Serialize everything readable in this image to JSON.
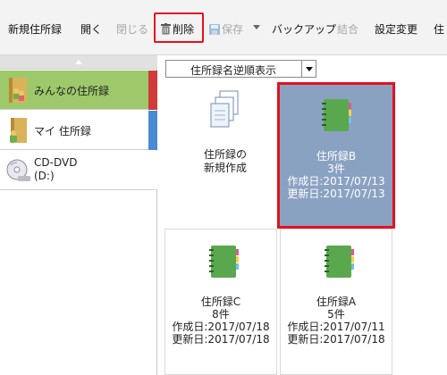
{
  "toolbar": {
    "new_addressbook": "新規住所録",
    "open": "開く",
    "close": "閉じる",
    "delete": "削除",
    "save": "保存",
    "backup": "バックアップ",
    "merge": "結合",
    "settings": "設定変更",
    "more": "住"
  },
  "sidebar": {
    "items": [
      {
        "label": "みんなの住所録",
        "selected": true,
        "stripe": "#d03a3a"
      },
      {
        "label": "マイ 住所録",
        "selected": false,
        "stripe": "#4a8ad4"
      },
      {
        "label_line1": "CD-DVD",
        "label_line2": "(D:)"
      }
    ]
  },
  "main": {
    "sort_select": "住所録名逆順表示",
    "new_tile": {
      "line1": "住所録の",
      "line2": "新規作成"
    },
    "tiles": [
      {
        "name": "住所録B",
        "count": "3件",
        "created": "作成日:2017/07/13",
        "updated": "更新日:2017/07/13",
        "selected": true
      },
      {
        "name": "住所録C",
        "count": "8件",
        "created": "作成日:2017/07/18",
        "updated": "更新日:2017/07/18",
        "selected": false
      },
      {
        "name": "住所録A",
        "count": "5件",
        "created": "作成日:2017/07/11",
        "updated": "更新日:2017/07/18",
        "selected": false
      }
    ]
  },
  "colors": {
    "selected_sidebar": "#9dc96a",
    "selected_tile": "#8aa2c2",
    "highlight": "#e5101f",
    "book_green": "#5aa84e"
  }
}
